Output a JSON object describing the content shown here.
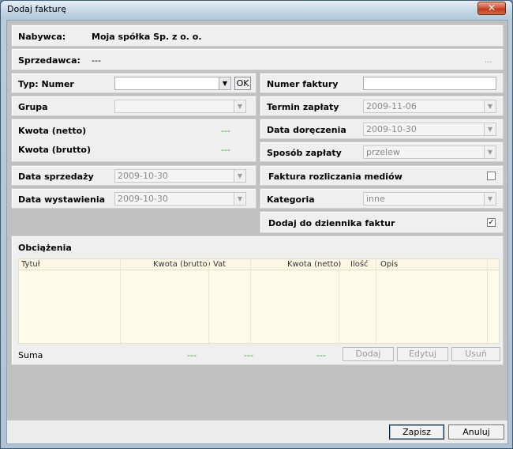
{
  "window": {
    "title": "Dodaj fakturę",
    "close_symbol": "✕"
  },
  "buyer": {
    "label": "Nabywca:",
    "value": "Moja spółka Sp. z o. o."
  },
  "seller": {
    "label": "Sprzedawca:",
    "value": "---",
    "more": "..."
  },
  "type": {
    "label": "Typ: Numer",
    "value": "",
    "ok_label": "OK"
  },
  "invoice_number": {
    "label": "Numer faktury",
    "value": ""
  },
  "group": {
    "label": "Grupa",
    "value": ""
  },
  "due_date": {
    "label": "Termin zapłaty",
    "value": "2009-11-06"
  },
  "amounts": {
    "net_label": "Kwota (netto)",
    "net_value": "---",
    "gross_label": "Kwota (brutto)",
    "gross_value": "---"
  },
  "delivery_date": {
    "label": "Data doręczenia",
    "value": "2009-10-30"
  },
  "payment_method": {
    "label": "Sposób zapłaty",
    "value": "przelew"
  },
  "sale_date": {
    "label": "Data sprzedaży",
    "value": "2009-10-30"
  },
  "media_invoice": {
    "label": "Faktura rozliczania mediów",
    "checked": false,
    "mark": ""
  },
  "issue_date": {
    "label": "Data wystawienia",
    "value": "2009-10-30"
  },
  "category": {
    "label": "Kategoria",
    "value": "inne"
  },
  "journal": {
    "label": "Dodaj do dziennika faktur",
    "checked": true,
    "mark": "✓"
  },
  "charges": {
    "title": "Obciążenia",
    "columns": [
      "Tytuł",
      "Kwota (brutto)",
      "Vat",
      "Kwota (netto)",
      "Ilość",
      "Opis"
    ],
    "sum_label": "Suma",
    "sum_gross": "---",
    "sum_vat": "---",
    "sum_net": "---",
    "add_label": "Dodaj",
    "edit_label": "Edytuj",
    "delete_label": "Usuń"
  },
  "footer": {
    "save_label": "Zapisz",
    "cancel_label": "Anuluj"
  },
  "icons": {
    "dropdown": "▼"
  }
}
